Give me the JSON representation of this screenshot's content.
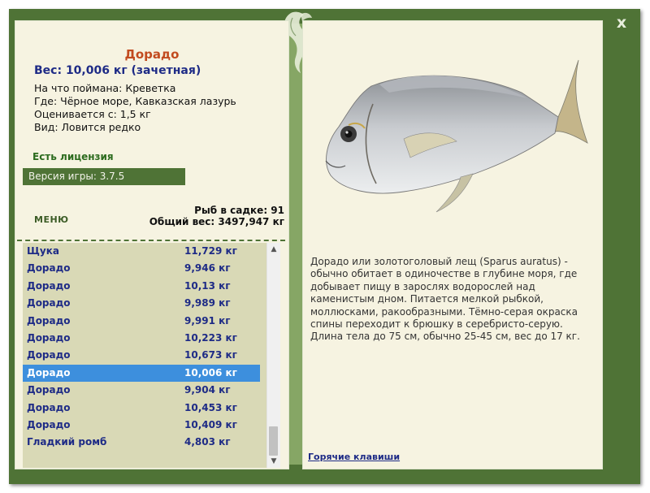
{
  "window": {
    "close_symbol": "x",
    "accent_dark": "#4f7336",
    "accent_light": "#86a665",
    "panel_bg": "#f6f3e1",
    "decoration_icon": "leaf-icon"
  },
  "left": {
    "fish_name": "Дорадо",
    "weight_line": "Вес: 10,006 кг (зачетная)",
    "caught_on": "На что поймана: Креветка",
    "location": "Где: Чёрное море, Кавказская лазурь",
    "estimated": "Оценивается с: 1,5 кг",
    "kind": "Вид: Ловится редко",
    "license": "Есть лицензия",
    "version": "Версия игры: 3.7.5",
    "menu_label": "МЕНЮ",
    "fish_in_keepnet": "Рыб в садке: 91",
    "total_weight": "Общий вес: 3497,947 кг"
  },
  "catch_list": [
    {
      "name": "Щука",
      "weight": "11,729 кг",
      "selected": false
    },
    {
      "name": "Дорадо",
      "weight": "9,946 кг",
      "selected": false
    },
    {
      "name": "Дорадо",
      "weight": "10,13 кг",
      "selected": false
    },
    {
      "name": "Дорадо",
      "weight": "9,989 кг",
      "selected": false
    },
    {
      "name": "Дорадо",
      "weight": "9,991 кг",
      "selected": false
    },
    {
      "name": "Дорадо",
      "weight": "10,223 кг",
      "selected": false
    },
    {
      "name": "Дорадо",
      "weight": "10,673 кг",
      "selected": false
    },
    {
      "name": "Дорадо",
      "weight": "10,006 кг",
      "selected": true
    },
    {
      "name": "Дорадо",
      "weight": "9,904 кг",
      "selected": false
    },
    {
      "name": "Дорадо",
      "weight": "10,453 кг",
      "selected": false
    },
    {
      "name": "Дорадо",
      "weight": "10,409 кг",
      "selected": false
    },
    {
      "name": "Гладкий ромб",
      "weight": "4,803 кг",
      "selected": false
    }
  ],
  "scrollbar": {
    "up_icon": "arrow-up-icon",
    "down_icon": "arrow-down-icon"
  },
  "right": {
    "image": "dorado-fish-image",
    "description_lines": [
      "Дорадо или золотоголовый лещ (Sparus auratus) -",
      "обычно обитает в одиночестве в глубине моря, где",
      "добывает пищу в зарослях водорослей над",
      "каменистым дном. Питается мелкой рыбкой,",
      "моллюсками, ракообразными. Тёмно-серая окраска",
      "спины переходит к брюшку в серебристо-серую.",
      "Длина тела до 75 см, обычно 25-45 см, вес до 17 кг."
    ],
    "hotkeys_label": "Горячие клавиши"
  }
}
